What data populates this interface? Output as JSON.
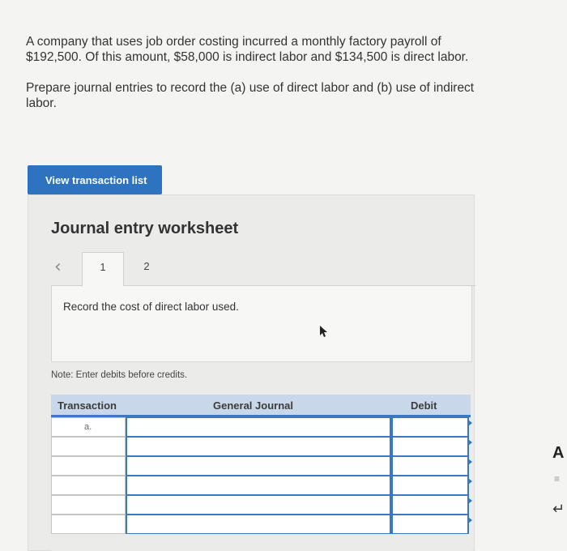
{
  "question": {
    "paragraph1": "A company that uses job order costing incurred a monthly factory payroll of $192,500. Of this amount, $58,000 is indirect labor and $134,500 is direct labor.",
    "paragraph2": "Prepare journal entries to record the (a) use of direct labor and (b) use of indirect labor."
  },
  "view_button": "View transaction list",
  "worksheet": {
    "title": "Journal entry worksheet",
    "prev_icon": "chevron-left-icon",
    "tabs": [
      "1",
      "2"
    ],
    "instruction": "Record the cost of direct labor used.",
    "note": "Note: Enter debits before credits.",
    "table": {
      "headers": [
        "Transaction",
        "General Journal",
        "Debit"
      ],
      "rows": [
        {
          "transaction": "a."
        },
        {
          "transaction": ""
        },
        {
          "transaction": ""
        },
        {
          "transaction": ""
        },
        {
          "transaction": ""
        },
        {
          "transaction": ""
        }
      ]
    }
  },
  "side": {
    "letter": "A"
  }
}
